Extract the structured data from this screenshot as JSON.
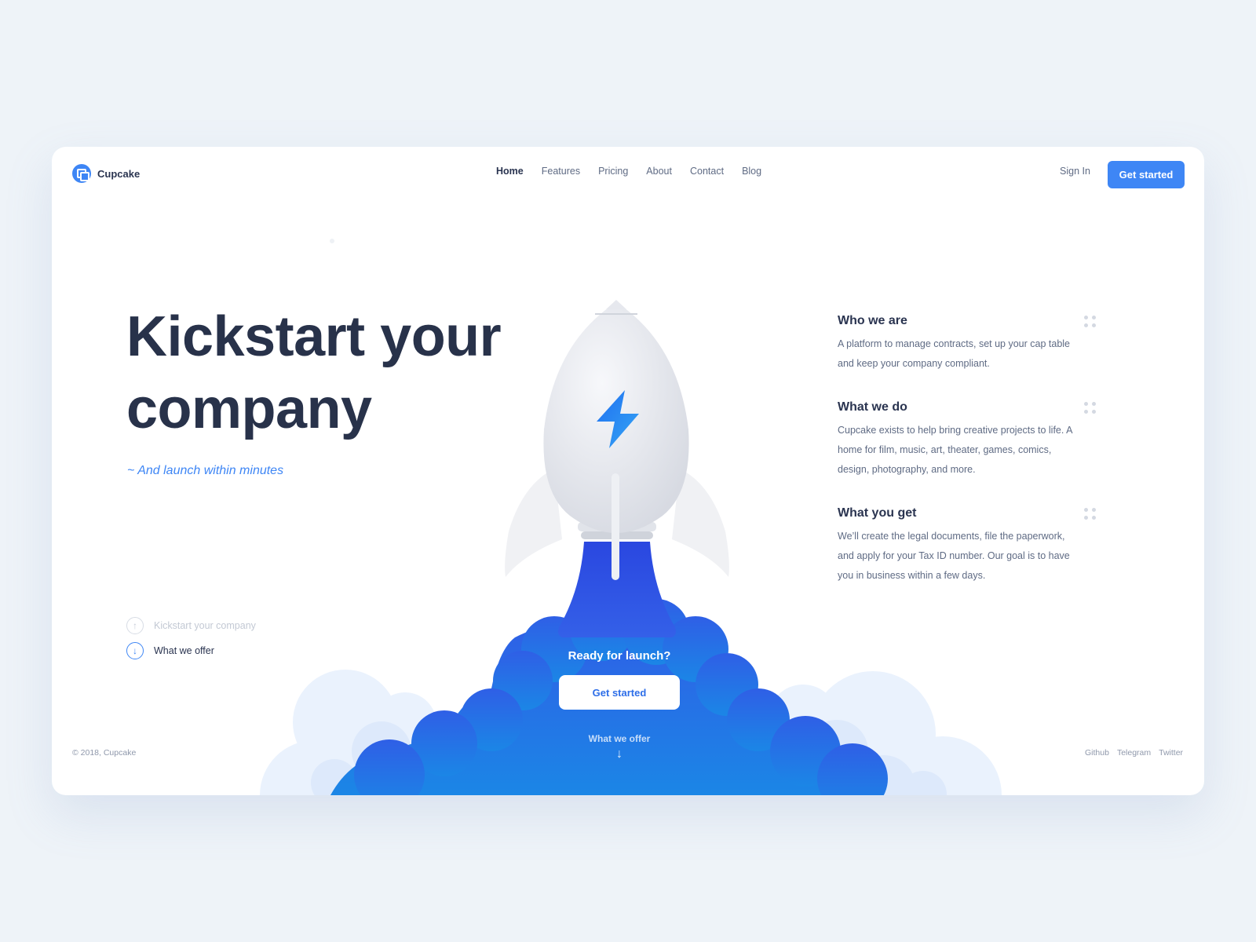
{
  "brand": {
    "name": "Cupcake"
  },
  "nav": {
    "items": [
      {
        "label": "Home",
        "active": true
      },
      {
        "label": "Features",
        "active": false
      },
      {
        "label": "Pricing",
        "active": false
      },
      {
        "label": "About",
        "active": false
      },
      {
        "label": "Contact",
        "active": false
      },
      {
        "label": "Blog",
        "active": false
      }
    ],
    "signin_label": "Sign In",
    "cta_label": "Get started"
  },
  "hero": {
    "title": "Kickstart your company",
    "subtitle": "~ And launch within minutes"
  },
  "steps": [
    {
      "label": "Kickstart your company",
      "icon": "arrow-up-circle-icon",
      "active": false
    },
    {
      "label": "What we offer",
      "icon": "arrow-down-circle-icon",
      "active": true
    }
  ],
  "features": [
    {
      "title": "Who we are",
      "text": "A platform to manage contracts, set up your cap table and keep your company compliant."
    },
    {
      "title": "What we do",
      "text": "Cupcake exists to help bring creative projects to life. A home for film, music, art, theater, games, comics, design, photography, and more."
    },
    {
      "title": "What you get",
      "text": "We’ll create the legal documents, file the paperwork, and apply for your Tax ID number. Our goal is to have you in business within a few days."
    }
  ],
  "launch": {
    "title": "Ready for launch?",
    "button_label": "Get started",
    "more_label": "What we offer",
    "arrow": "↓"
  },
  "footer": {
    "copyright": "© 2018, Cupcake",
    "links": [
      "Github",
      "Telegram",
      "Twitter"
    ]
  },
  "colors": {
    "accent": "#3e86f5",
    "heading": "#28324a",
    "text": "#5f6b84",
    "background": "#eef3f8"
  }
}
